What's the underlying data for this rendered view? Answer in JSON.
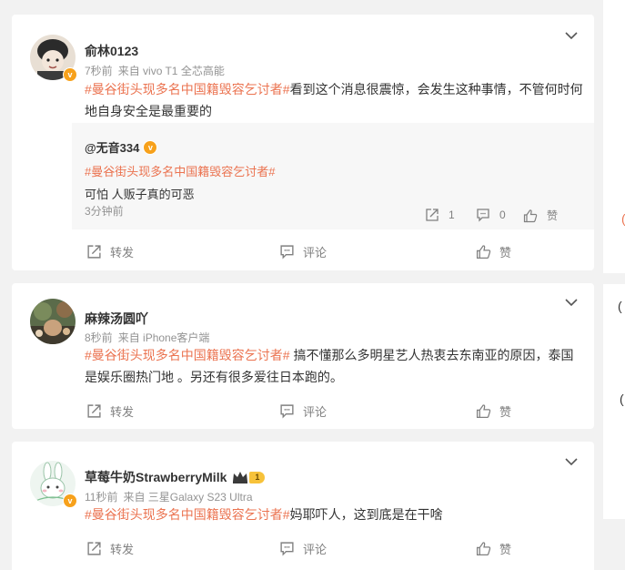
{
  "posts": [
    {
      "username": "俞林0123",
      "time": "7秒前",
      "source": "来自 vivo T1 全芯高能",
      "topic": "#曼谷街头现多名中国籍毁容乞讨者#",
      "text": "看到这个消息很震惊，会发生这种事情，不管何时何地自身安全是最重要的",
      "repost": {
        "username": "@无音334",
        "topic": "#曼谷街头现多名中国籍毁容乞讨者#",
        "text": "可怕 人贩子真的可恶",
        "time": "3分钟前",
        "reposts": "1",
        "comments": "0",
        "like_label": "赞"
      },
      "actions": {
        "repost": "转发",
        "comment": "评论",
        "like": "赞"
      }
    },
    {
      "username": "麻辣汤圆吖",
      "time": "8秒前",
      "source": "来自 iPhone客户端",
      "topic": "#曼谷街头现多名中国籍毁容乞讨者#",
      "text": " 搞不懂那么多明星艺人热衷去东南亚的原因，泰国是娱乐圈热门地 。另还有很多爱往日本跑的。",
      "actions": {
        "repost": "转发",
        "comment": "评论",
        "like": "赞"
      }
    },
    {
      "username": "草莓牛奶StrawberryMilk",
      "member_level": "1",
      "time": "11秒前",
      "source": "来自 三星Galaxy S23 Ultra",
      "topic": "#曼谷街头现多名中国籍毁容乞讨者#",
      "text": "妈耶吓人，这到底是在干啥",
      "actions": {
        "repost": "转发",
        "comment": "评论",
        "like": "赞"
      }
    }
  ],
  "colors": {
    "topic": "#eb7350",
    "meta": "#939393",
    "badge": "#f7a11b"
  },
  "icons": [
    "chevron-down-icon",
    "repost-icon",
    "comment-icon",
    "like-icon",
    "verified-badge-icon",
    "crown-icon"
  ]
}
